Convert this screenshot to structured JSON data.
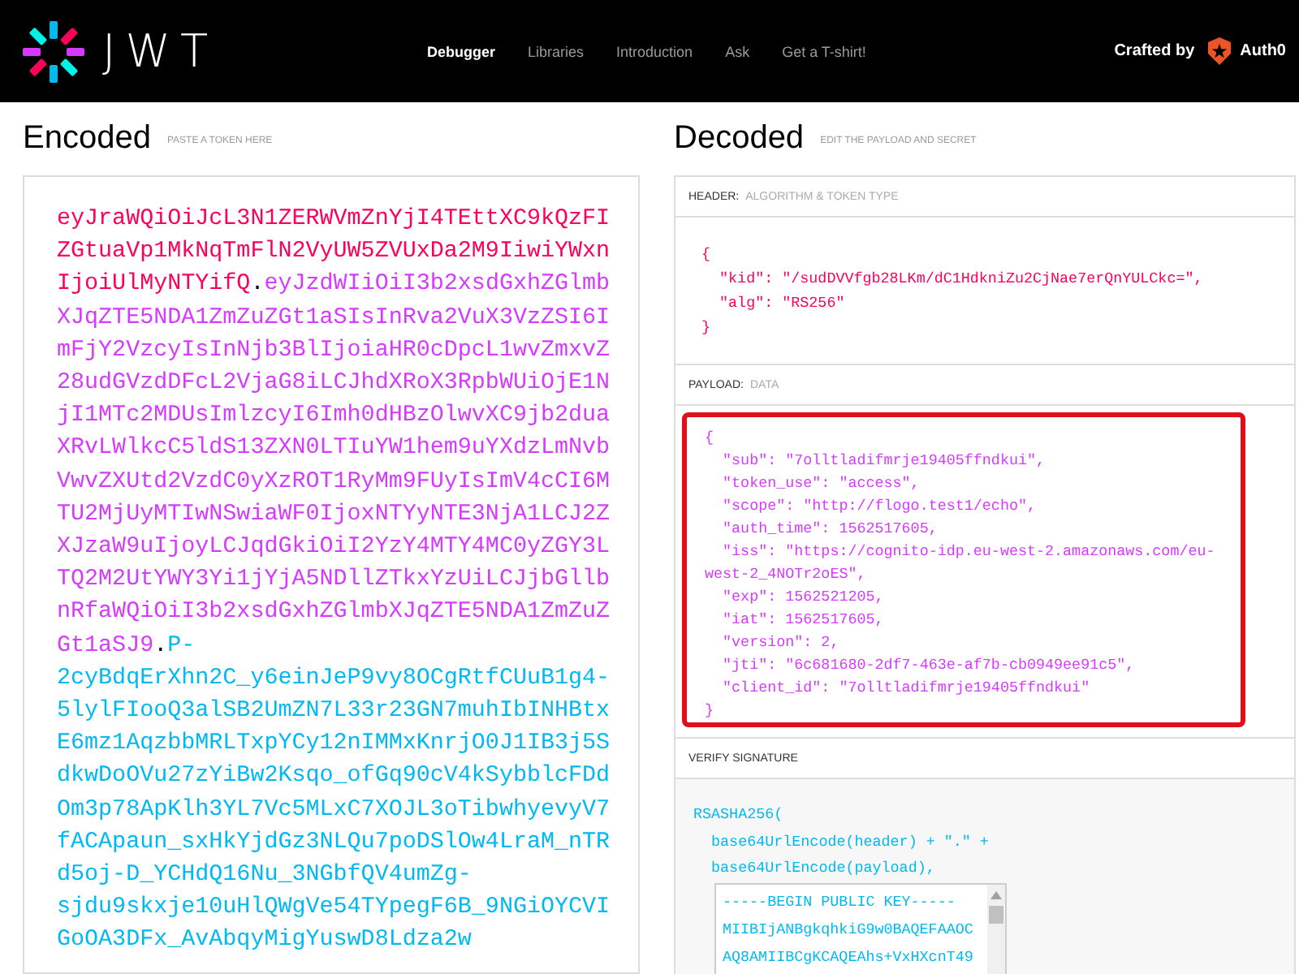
{
  "navbar": {
    "logo_text": "JWT",
    "links": [
      {
        "label": "Debugger",
        "selected": true
      },
      {
        "label": "Libraries",
        "selected": false
      },
      {
        "label": "Introduction",
        "selected": false
      },
      {
        "label": "Ask",
        "selected": false
      },
      {
        "label": "Get a T-shirt!",
        "selected": false
      }
    ],
    "crafted_by": "Crafted by",
    "brand": "Auth0"
  },
  "encoded": {
    "title": "Encoded",
    "hint": "PASTE A TOKEN HERE",
    "token_lines": [
      [
        {
          "kind": "header",
          "text": "eyJraWQiOiJcL3N1ZERWVmZnYjI4TEttXC9kQzFI"
        }
      ],
      [
        {
          "kind": "header",
          "text": "ZGtuaVp1MkNqTmFlN2VyUW5ZVUxDa2M9IiwiYWxn"
        }
      ],
      [
        {
          "kind": "header",
          "text": "IjoiUlMyNTYifQ"
        },
        {
          "kind": "dot",
          "text": "."
        },
        {
          "kind": "payload",
          "text": "eyJzdWIiOiI3b2xsdGxhZGlmb"
        }
      ],
      [
        {
          "kind": "payload",
          "text": "XJqZTE5NDA1ZmZuZGt1aSIsInRva2VuX3VzZSI6I"
        }
      ],
      [
        {
          "kind": "payload",
          "text": "mFjY2VzcyIsInNjb3BlIjoiaHR0cDpcL1wvZmxvZ"
        }
      ],
      [
        {
          "kind": "payload",
          "text": "28udGVzdDFcL2VjaG8iLCJhdXRoX3RpbWUiOjE1N"
        }
      ],
      [
        {
          "kind": "payload",
          "text": "jI1MTc2MDUsImlzcyI6Imh0dHBzOlwvXC9jb2dua"
        }
      ],
      [
        {
          "kind": "payload",
          "text": "XRvLWlkcC5ldS13ZXN0LTIuYW1hem9uYXdzLmNvb"
        }
      ],
      [
        {
          "kind": "payload",
          "text": "VwvZXUtd2VzdC0yXzROT1RyMm9FUyIsImV4cCI6M"
        }
      ],
      [
        {
          "kind": "payload",
          "text": "TU2MjUyMTIwNSwiaWF0IjoxNTYyNTE3NjA1LCJ2Z"
        }
      ],
      [
        {
          "kind": "payload",
          "text": "XJzaW9uIjoyLCJqdGkiOiI2YzY4MTY4MC0yZGY3L"
        }
      ],
      [
        {
          "kind": "payload",
          "text": "TQ2M2UtYWY3Yi1jYjA5NDllZTkxYzUiLCJjbGllb"
        }
      ],
      [
        {
          "kind": "payload",
          "text": "nRfaWQiOiI3b2xsdGxhZGlmbXJqZTE5NDA1ZmZuZ"
        }
      ],
      [
        {
          "kind": "payload",
          "text": "Gt1aSJ9"
        },
        {
          "kind": "dot",
          "text": "."
        },
        {
          "kind": "signature",
          "text": "P-"
        }
      ],
      [
        {
          "kind": "signature",
          "text": "2cyBdqErXhn2C_y6einJeP9vy8OCgRtfCUuB1g4-"
        }
      ],
      [
        {
          "kind": "signature",
          "text": "5lylFIooQ3alSB2UmZN7L33r23GN7muhIbINHBtx"
        }
      ],
      [
        {
          "kind": "signature",
          "text": "E6mz1AqzbbMRLTxpYCy12nIMMxKnrjO0J1IB3j5S"
        }
      ],
      [
        {
          "kind": "signature",
          "text": "dkwDoOVu27zYiBw2Ksqo_ofGq90cV4kSybblcFDd"
        }
      ],
      [
        {
          "kind": "signature",
          "text": "Om3p78ApKlh3YL7Vc5MLxC7XOJL3oTibwhyevyV7"
        }
      ],
      [
        {
          "kind": "signature",
          "text": "fACApaun_sxHkYjdGz3NLQu7poDSlOw4LraM_nTR"
        }
      ],
      [
        {
          "kind": "signature",
          "text": "d5oj-D_YCHdQ16Nu_3NGbfQV4umZg-"
        }
      ],
      [
        {
          "kind": "signature",
          "text": "sjdu9skxje10uHlQWgVe54TYpegF6B_9NGiOYCVI"
        }
      ],
      [
        {
          "kind": "signature",
          "text": "GoOA3DFx_AvAbqyMigYuswD8Ldza2w"
        }
      ]
    ]
  },
  "decoded": {
    "title": "Decoded",
    "hint": "EDIT THE PAYLOAD AND SECRET",
    "header": {
      "label": "HEADER:",
      "hint": "ALGORITHM & TOKEN TYPE",
      "lines": [
        "{",
        "  \"kid\": \"/sudDVVfgb28LKm/dC1HdkniZu2CjNae7erQnYULCkc=\",",
        "  \"alg\": \"RS256\"",
        "}"
      ]
    },
    "payload": {
      "label": "PAYLOAD:",
      "hint": "DATA",
      "highlighted": true,
      "lines": [
        "{",
        "  \"sub\": \"7olltladifmrje19405ffndkui\",",
        "  \"token_use\": \"access\",",
        "  \"scope\": \"http://flogo.test1/echo\",",
        "  \"auth_time\": 1562517605,",
        "  \"iss\": \"https://cognito-idp.eu-west-2.amazonaws.com/eu-",
        "west-2_4NOTr2oES\",",
        "  \"exp\": 1562521205,",
        "  \"iat\": 1562517605,",
        "  \"version\": 2,",
        "  \"jti\": \"6c681680-2df7-463e-af7b-cb0949ee91c5\",",
        "  \"client_id\": \"7olltladifmrje19405ffndkui\"",
        "}"
      ]
    },
    "signature": {
      "label": "VERIFY SIGNATURE",
      "lines": [
        "RSASHA256(",
        "  base64UrlEncode(header) + \".\" +",
        "  base64UrlEncode(payload),"
      ],
      "public_key_lines": [
        "-----BEGIN PUBLIC KEY-----",
        "MIIBIjANBgkqhkiG9w0BAQEFAAOC",
        "AQ8AMIIBCgKCAQEAhs+VxHXcnT49"
      ]
    }
  }
}
